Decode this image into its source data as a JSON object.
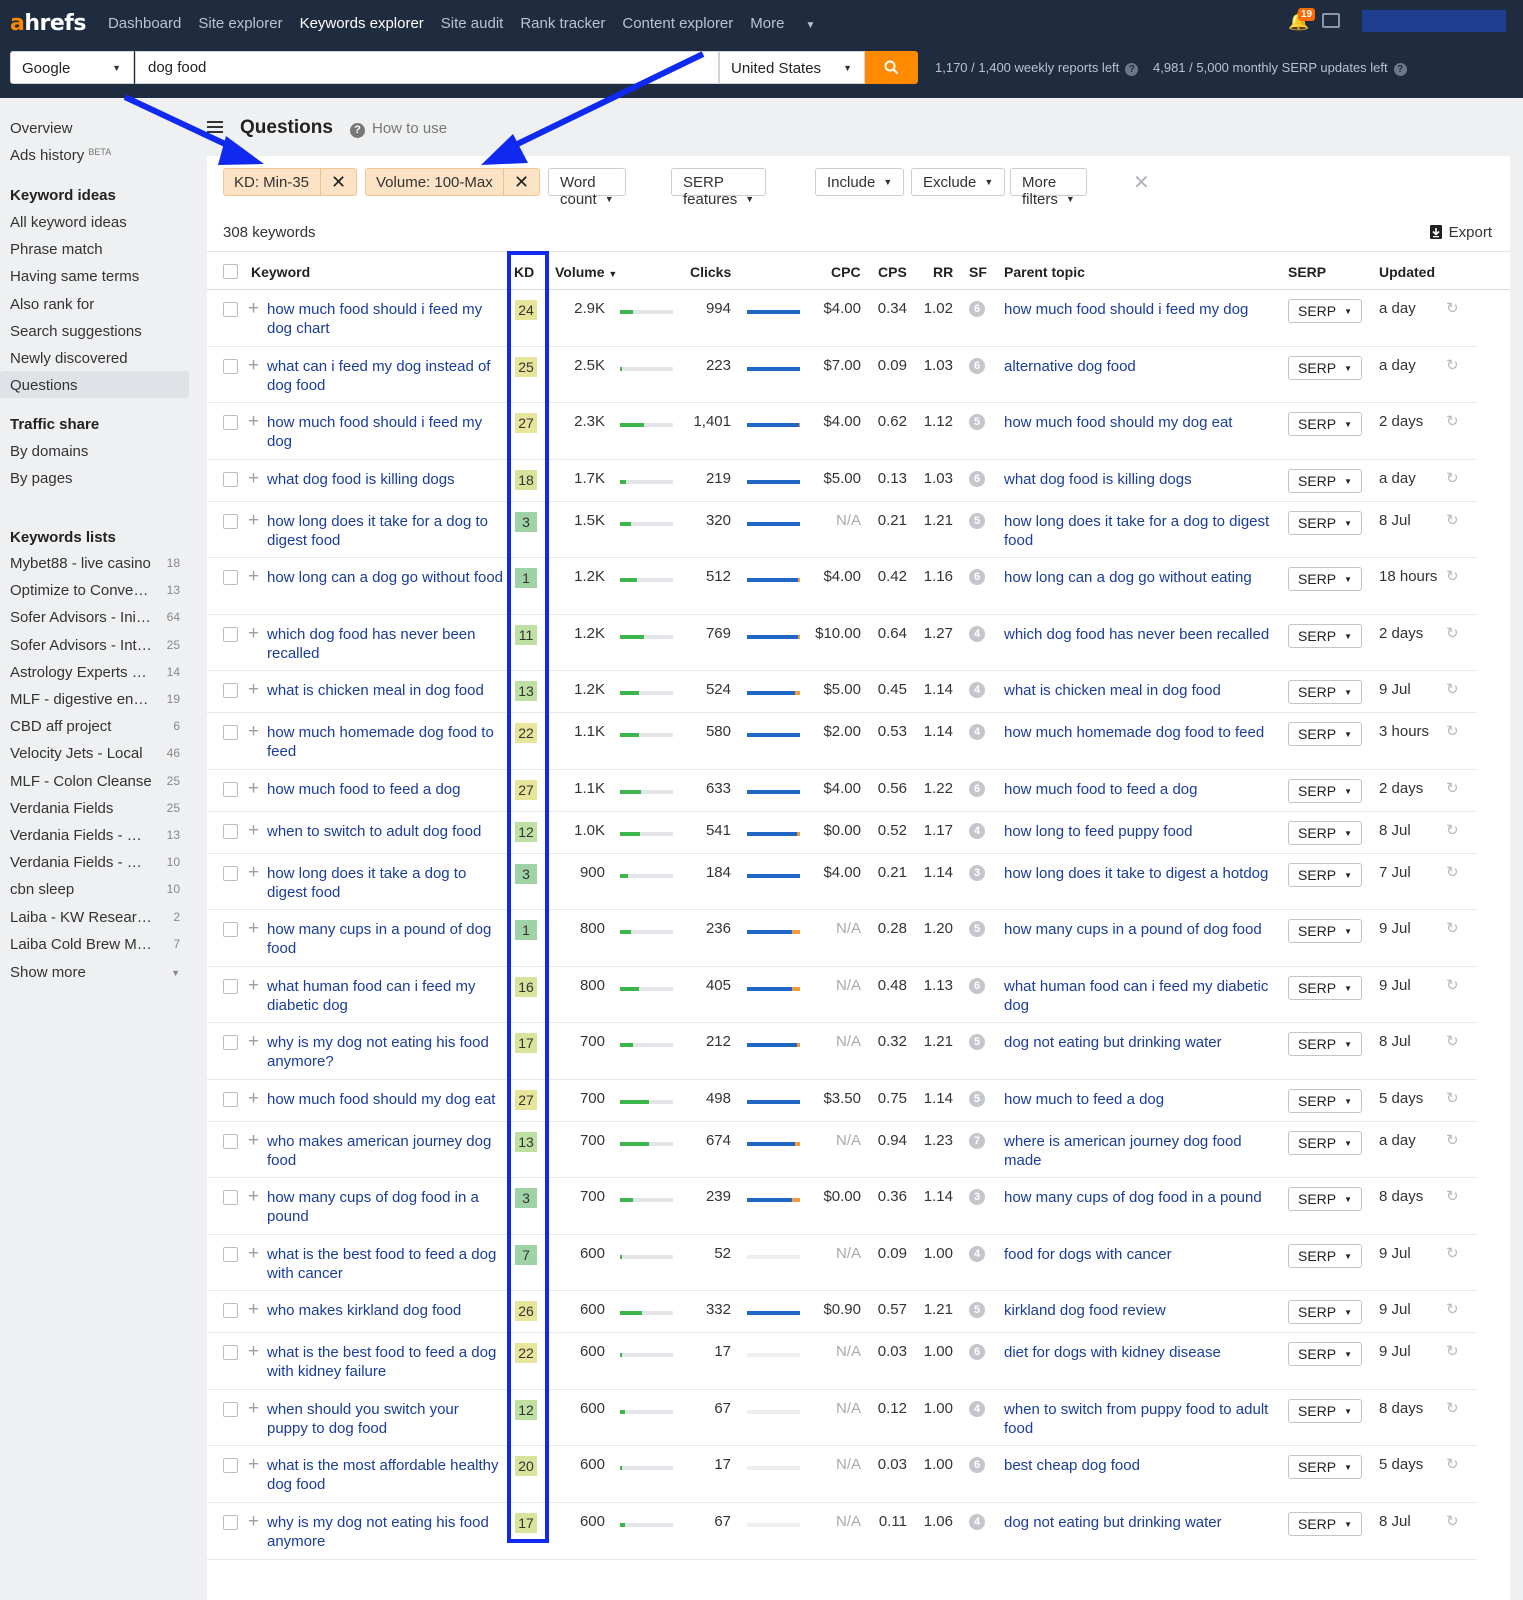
{
  "brand": {
    "logo_a": "a",
    "logo_rest": "hrefs"
  },
  "nav": [
    {
      "label": "Dashboard",
      "active": false
    },
    {
      "label": "Site explorer",
      "active": false
    },
    {
      "label": "Keywords explorer",
      "active": true
    },
    {
      "label": "Site audit",
      "active": false
    },
    {
      "label": "Rank tracker",
      "active": false
    },
    {
      "label": "Content explorer",
      "active": false
    },
    {
      "label": "More",
      "active": false
    }
  ],
  "notifications": {
    "count": "19"
  },
  "search": {
    "engine": "Google",
    "query": "dog food",
    "country": "United States",
    "weekly_quota": "1,170 / 1,400 weekly reports left",
    "monthly_quota": "4,981 / 5,000 monthly SERP updates left"
  },
  "sidebar": {
    "top": [
      {
        "label": "Overview"
      },
      {
        "label": "Ads history",
        "badge": "BETA"
      }
    ],
    "keyword_ideas_head": "Keyword ideas",
    "keyword_ideas": [
      {
        "label": "All keyword ideas"
      },
      {
        "label": "Phrase match"
      },
      {
        "label": "Having same terms"
      },
      {
        "label": "Also rank for"
      },
      {
        "label": "Search suggestions"
      },
      {
        "label": "Newly discovered"
      },
      {
        "label": "Questions",
        "selected": true
      }
    ],
    "traffic_head": "Traffic share",
    "traffic": [
      {
        "label": "By domains"
      },
      {
        "label": "By pages"
      }
    ],
    "lists_head": "Keywords lists",
    "lists": [
      {
        "label": "Mybet88 - live casino",
        "count": "18"
      },
      {
        "label": "Optimize to Conversion",
        "count": "13"
      },
      {
        "label": "Sofer Advisors - Initial",
        "count": "64"
      },
      {
        "label": "Sofer Advisors - Intent",
        "count": "25"
      },
      {
        "label": "Astrology Experts List",
        "count": "14"
      },
      {
        "label": "MLF - digestive enzymes",
        "count": "19"
      },
      {
        "label": "CBD aff project",
        "count": "6"
      },
      {
        "label": "Velocity Jets - Local",
        "count": "46"
      },
      {
        "label": "MLF - Colon Cleanse",
        "count": "25"
      },
      {
        "label": "Verdania Fields",
        "count": "25"
      },
      {
        "label": "Verdania Fields - CBD",
        "count": "13"
      },
      {
        "label": "Verdania Fields - Color",
        "count": "10"
      },
      {
        "label": "cbn sleep",
        "count": "10"
      },
      {
        "label": "Laiba - KW Research",
        "count": "2"
      },
      {
        "label": "Laiba Cold Brew Market",
        "count": "7"
      }
    ],
    "show_more": "Show more"
  },
  "page": {
    "title": "Questions",
    "how_to": "How to use"
  },
  "filters": {
    "chips": [
      "KD: Min-35",
      "Volume: 100-Max"
    ],
    "buttons": [
      "Word count",
      "SERP features",
      "Include",
      "Exclude",
      "More filters"
    ]
  },
  "results": {
    "count": "308 keywords",
    "export": "Export"
  },
  "columns": {
    "keyword": "Keyword",
    "kd": "KD",
    "volume": "Volume",
    "clicks": "Clicks",
    "cpc": "CPC",
    "cps": "CPS",
    "rr": "RR",
    "sf": "SF",
    "parent": "Parent topic",
    "serp": "SERP",
    "updated": "Updated"
  },
  "rows": [
    {
      "kw": "how much food should i feed my dog chart",
      "kd": "24",
      "vol": "2.9K",
      "vp": 0.24,
      "clicks": "994",
      "cp": 1.0,
      "org": 0.0,
      "cpc": "$4.00",
      "cps": "0.34",
      "rr": "1.02",
      "sf": "6",
      "parent": "how much food should i feed my dog",
      "updated": "a day"
    },
    {
      "kw": "what can i feed my dog instead of dog food",
      "kd": "25",
      "vol": "2.5K",
      "vp": 0.04,
      "clicks": "223",
      "cp": 1.0,
      "org": 0.0,
      "cpc": "$7.00",
      "cps": "0.09",
      "rr": "1.03",
      "sf": "6",
      "parent": "alternative dog food",
      "updated": "a day"
    },
    {
      "kw": "how much food should i feed my dog",
      "kd": "27",
      "vol": "2.3K",
      "vp": 0.45,
      "clicks": "1,401",
      "cp": 0.98,
      "org": 0.02,
      "cpc": "$4.00",
      "cps": "0.62",
      "rr": "1.12",
      "sf": "5",
      "parent": "how much food should my dog eat",
      "updated": "2 days"
    },
    {
      "kw": "what dog food is killing dogs",
      "kd": "18",
      "vol": "1.7K",
      "vp": 0.12,
      "clicks": "219",
      "cp": 1.0,
      "org": 0.0,
      "cpc": "$5.00",
      "cps": "0.13",
      "rr": "1.03",
      "sf": "6",
      "parent": "what dog food is killing dogs",
      "updated": "a day"
    },
    {
      "kw": "how long does it take for a dog to digest food",
      "kd": "3",
      "vol": "1.5K",
      "vp": 0.2,
      "clicks": "320",
      "cp": 1.0,
      "org": 0.0,
      "cpc": "N/A",
      "cps": "0.21",
      "rr": "1.21",
      "sf": "5",
      "parent": "how long does it take for a dog to digest food",
      "updated": "8 Jul"
    },
    {
      "kw": "how long can a dog go without food",
      "kd": "1",
      "vol": "1.2K",
      "vp": 0.32,
      "clicks": "512",
      "cp": 0.96,
      "org": 0.04,
      "cpc": "$4.00",
      "cps": "0.42",
      "rr": "1.16",
      "sf": "6",
      "parent": "how long can a dog go without eating",
      "updated": "18 hours"
    },
    {
      "kw": "which dog food has never been recalled",
      "kd": "11",
      "vol": "1.2K",
      "vp": 0.45,
      "clicks": "769",
      "cp": 0.97,
      "org": 0.03,
      "cpc": "$10.00",
      "cps": "0.64",
      "rr": "1.27",
      "sf": "4",
      "parent": "which dog food has never been recalled",
      "updated": "2 days"
    },
    {
      "kw": "what is chicken meal in dog food",
      "kd": "13",
      "vol": "1.2K",
      "vp": 0.35,
      "clicks": "524",
      "cp": 0.9,
      "org": 0.1,
      "cpc": "$5.00",
      "cps": "0.45",
      "rr": "1.14",
      "sf": "4",
      "parent": "what is chicken meal in dog food",
      "updated": "9 Jul"
    },
    {
      "kw": "how much homemade dog food to feed",
      "kd": "22",
      "vol": "1.1K",
      "vp": 0.35,
      "clicks": "580",
      "cp": 1.0,
      "org": 0.0,
      "cpc": "$2.00",
      "cps": "0.53",
      "rr": "1.14",
      "sf": "4",
      "parent": "how much homemade dog food to feed",
      "updated": "3 hours"
    },
    {
      "kw": "how much food to feed a dog",
      "kd": "27",
      "vol": "1.1K",
      "vp": 0.4,
      "clicks": "633",
      "cp": 1.0,
      "org": 0.0,
      "cpc": "$4.00",
      "cps": "0.56",
      "rr": "1.22",
      "sf": "6",
      "parent": "how much food to feed a dog",
      "updated": "2 days"
    },
    {
      "kw": "when to switch to adult dog food",
      "kd": "12",
      "vol": "1.0K",
      "vp": 0.38,
      "clicks": "541",
      "cp": 0.95,
      "org": 0.05,
      "cpc": "$0.00",
      "cps": "0.52",
      "rr": "1.17",
      "sf": "4",
      "parent": "how long to feed puppy food",
      "updated": "8 Jul"
    },
    {
      "kw": "how long does it take a dog to digest food",
      "kd": "3",
      "vol": "900",
      "vp": 0.16,
      "clicks": "184",
      "cp": 1.0,
      "org": 0.0,
      "cpc": "$4.00",
      "cps": "0.21",
      "rr": "1.14",
      "sf": "3",
      "parent": "how long does it take to digest a hotdog",
      "updated": "7 Jul"
    },
    {
      "kw": "how many cups in a pound of dog food",
      "kd": "1",
      "vol": "800",
      "vp": 0.2,
      "clicks": "236",
      "cp": 0.85,
      "org": 0.15,
      "cpc": "N/A",
      "cps": "0.28",
      "rr": "1.20",
      "sf": "5",
      "parent": "how many cups in a pound of dog food",
      "updated": "9 Jul"
    },
    {
      "kw": "what human food can i feed my diabetic dog",
      "kd": "16",
      "vol": "800",
      "vp": 0.35,
      "clicks": "405",
      "cp": 0.85,
      "org": 0.15,
      "cpc": "N/A",
      "cps": "0.48",
      "rr": "1.13",
      "sf": "6",
      "parent": "what human food can i feed my diabetic dog",
      "updated": "9 Jul"
    },
    {
      "kw": "why is my dog not eating his food anymore?",
      "kd": "17",
      "vol": "700",
      "vp": 0.25,
      "clicks": "212",
      "cp": 0.95,
      "org": 0.05,
      "cpc": "N/A",
      "cps": "0.32",
      "rr": "1.21",
      "sf": "5",
      "parent": "dog not eating but drinking water",
      "updated": "8 Jul"
    },
    {
      "kw": "how much food should my dog eat",
      "kd": "27",
      "vol": "700",
      "vp": 0.55,
      "clicks": "498",
      "cp": 1.0,
      "org": 0.0,
      "cpc": "$3.50",
      "cps": "0.75",
      "rr": "1.14",
      "sf": "5",
      "parent": "how much to feed a dog",
      "updated": "5 days"
    },
    {
      "kw": "who makes american journey dog food",
      "kd": "13",
      "vol": "700",
      "vp": 0.55,
      "clicks": "674",
      "cp": 0.9,
      "org": 0.1,
      "cpc": "N/A",
      "cps": "0.94",
      "rr": "1.23",
      "sf": "7",
      "parent": "where is american journey dog food made",
      "updated": "a day"
    },
    {
      "kw": "how many cups of dog food in a pound",
      "kd": "3",
      "vol": "700",
      "vp": 0.25,
      "clicks": "239",
      "cp": 0.85,
      "org": 0.15,
      "cpc": "$0.00",
      "cps": "0.36",
      "rr": "1.14",
      "sf": "3",
      "parent": "how many cups of dog food in a pound",
      "updated": "8 days"
    },
    {
      "kw": "what is the best food to feed a dog with cancer",
      "kd": "7",
      "vol": "600",
      "vp": 0.04,
      "clicks": "52",
      "cp": 0.0,
      "org": 0.0,
      "cpc": "N/A",
      "cps": "0.09",
      "rr": "1.00",
      "sf": "4",
      "parent": "food for dogs with cancer",
      "updated": "9 Jul"
    },
    {
      "kw": "who makes kirkland dog food",
      "kd": "26",
      "vol": "600",
      "vp": 0.42,
      "clicks": "332",
      "cp": 1.0,
      "org": 0.0,
      "cpc": "$0.90",
      "cps": "0.57",
      "rr": "1.21",
      "sf": "5",
      "parent": "kirkland dog food review",
      "updated": "9 Jul"
    },
    {
      "kw": "what is the best food to feed a dog with kidney failure",
      "kd": "22",
      "vol": "600",
      "vp": 0.04,
      "clicks": "17",
      "cp": 0.0,
      "org": 0.0,
      "cpc": "N/A",
      "cps": "0.03",
      "rr": "1.00",
      "sf": "6",
      "parent": "diet for dogs with kidney disease",
      "updated": "9 Jul"
    },
    {
      "kw": "when should you switch your puppy to dog food",
      "kd": "12",
      "vol": "600",
      "vp": 0.1,
      "clicks": "67",
      "cp": 0.0,
      "org": 0.0,
      "cpc": "N/A",
      "cps": "0.12",
      "rr": "1.00",
      "sf": "4",
      "parent": "when to switch from puppy food to adult food",
      "updated": "8 days"
    },
    {
      "kw": "what is the most affordable healthy dog food",
      "kd": "20",
      "vol": "600",
      "vp": 0.04,
      "clicks": "17",
      "cp": 0.0,
      "org": 0.0,
      "cpc": "N/A",
      "cps": "0.03",
      "rr": "1.00",
      "sf": "6",
      "parent": "best cheap dog food",
      "updated": "5 days"
    },
    {
      "kw": "why is my dog not eating his food anymore",
      "kd": "17",
      "vol": "600",
      "vp": 0.1,
      "clicks": "67",
      "cp": 0.0,
      "org": 0.0,
      "cpc": "N/A",
      "cps": "0.11",
      "rr": "1.06",
      "sf": "4",
      "parent": "dog not eating but drinking water",
      "updated": "8 Jul"
    }
  ],
  "ui_labels": {
    "serp_btn": "SERP"
  },
  "colors": {
    "accent": "#ff8a00",
    "link": "#1a3c9c",
    "annotation": "#1029f0",
    "topbar": "#1f2c40"
  }
}
